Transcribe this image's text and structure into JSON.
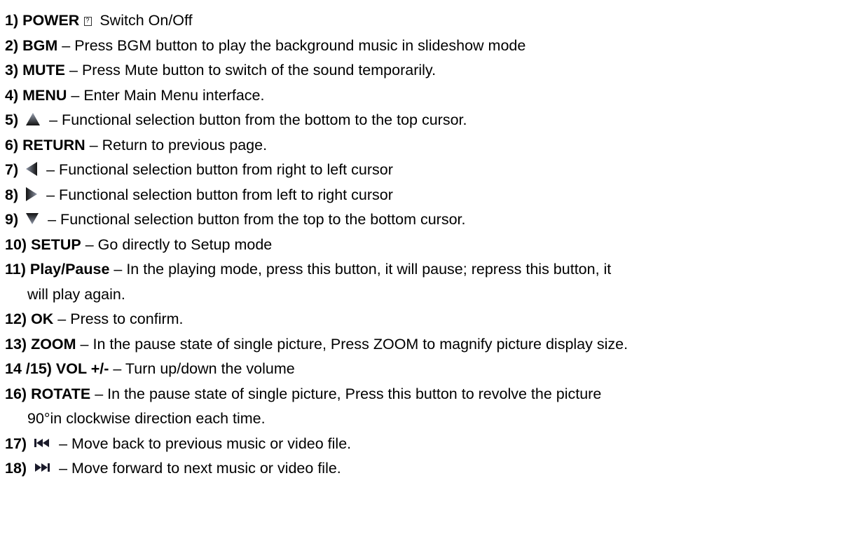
{
  "items": [
    {
      "num": "1)",
      "keyword": "POWER",
      "text": "Switch On/Off"
    },
    {
      "num": "2)",
      "keyword": "BGM",
      "text": "– Press BGM button to play the background music in slideshow mode"
    },
    {
      "num": "3)",
      "keyword": "MUTE",
      "text": "– Press Mute button to switch of the sound temporarily."
    },
    {
      "num": "4)",
      "keyword": "MENU",
      "text": "– Enter Main Menu interface."
    },
    {
      "num": "5)",
      "icon": "up-triangle-icon",
      "text": "– Functional selection button from the bottom to the top cursor."
    },
    {
      "num": "6)",
      "keyword": "RETURN",
      "text": "– Return to previous page."
    },
    {
      "num": "7)",
      "icon": "left-triangle-icon",
      "text": "– Functional selection button from right to left cursor"
    },
    {
      "num": "8)",
      "icon": "right-triangle-icon",
      "text": "– Functional selection button from left to right cursor"
    },
    {
      "num": "9)",
      "icon": "down-triangle-icon",
      "text": "– Functional selection button from the top to the bottom cursor."
    },
    {
      "num": "10)",
      "keyword": "SETUP",
      "text": "– Go directly to Setup mode"
    },
    {
      "num": "11)",
      "keyword": "Play/Pause",
      "text": "– In the playing mode, press this button, it will pause; repress this button, it",
      "cont": "will play again."
    },
    {
      "num": "12)",
      "keyword": "OK",
      "text": "– Press to confirm."
    },
    {
      "num": "13)",
      "keyword": "ZOOM",
      "text": "– In the pause state of single picture, Press ZOOM to magnify picture display size."
    },
    {
      "num": "14 /15)",
      "keyword": "VOL +/-",
      "text": "– Turn up/down the volume"
    },
    {
      "num": "16)",
      "keyword": "ROTATE",
      "text": "– In the pause state of single picture, Press this button to revolve the picture",
      "cont": "90°in clockwise direction each time."
    },
    {
      "num": "17)",
      "icon": "skip-previous-icon",
      "text": "– Move back to previous music or video file."
    },
    {
      "num": "18)",
      "icon": "skip-next-icon",
      "text": "– Move forward to next music or video file."
    }
  ]
}
